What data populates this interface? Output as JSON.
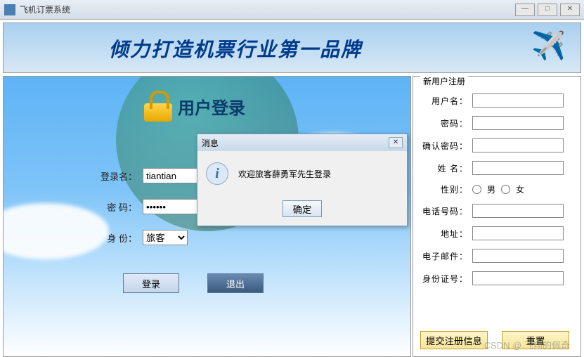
{
  "window": {
    "title": "飞机订票系统",
    "min": "—",
    "max": "□",
    "close": "✕"
  },
  "banner": {
    "slogan": "倾力打造机票行业第一品牌"
  },
  "login": {
    "header": "用户登录",
    "labels": {
      "username": "登录名：",
      "password": "密  码：",
      "role": "身  份："
    },
    "values": {
      "username": "tiantian",
      "password": "••••••",
      "role": "旅客"
    },
    "buttons": {
      "login": "登录",
      "exit": "退出"
    }
  },
  "register": {
    "legend": "新用户注册",
    "labels": {
      "username": "用户名：",
      "password": "密码：",
      "confirm": "确认密码：",
      "name": "姓  名：",
      "gender": "性别：",
      "male": "男",
      "female": "女",
      "phone": "电话号码：",
      "address": "地址：",
      "email": "电子邮件：",
      "idcard": "身份证号："
    },
    "buttons": {
      "submit": "提交注册信息",
      "reset": "重置"
    }
  },
  "modal": {
    "title": "消息",
    "message": "欢迎旅客薛勇军先生登录",
    "ok": "确定"
  },
  "watermark": "CSDN @ 飞翔的佩奇"
}
